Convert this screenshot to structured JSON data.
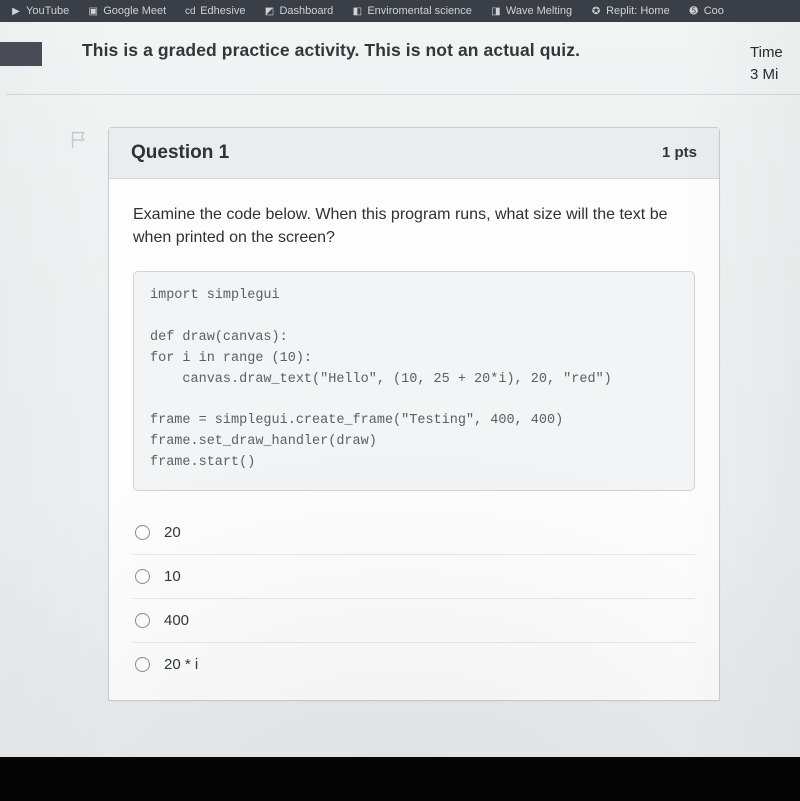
{
  "bookmarks": [
    {
      "icon": "▶",
      "label": "YouTube"
    },
    {
      "icon": "▣",
      "label": "Google Meet"
    },
    {
      "icon": "cd",
      "label": "Edhesive"
    },
    {
      "icon": "◩",
      "label": "Dashboard"
    },
    {
      "icon": "◧",
      "label": "Enviromental science"
    },
    {
      "icon": "◨",
      "label": "Wave Melting"
    },
    {
      "icon": "✪",
      "label": "Replit: Home"
    },
    {
      "icon": "➎",
      "label": "Coo"
    }
  ],
  "notice": "This is a graded practice activity. This is not an actual quiz.",
  "timer": {
    "line1": "Time",
    "line2": "3 Mi"
  },
  "question": {
    "title": "Question 1",
    "points": "1 pts",
    "stem": "Examine the code below. When this program runs, what size will the text be when printed on the screen?",
    "code": "import simplegui\n\ndef draw(canvas):\nfor i in range (10):\n    canvas.draw_text(\"Hello\", (10, 25 + 20*i), 20, \"red\")\n\nframe = simplegui.create_frame(\"Testing\", 400, 400)\nframe.set_draw_handler(draw)\nframe.start()",
    "options": [
      {
        "label": "20"
      },
      {
        "label": "10"
      },
      {
        "label": "400"
      },
      {
        "label": "20 * i"
      }
    ]
  }
}
